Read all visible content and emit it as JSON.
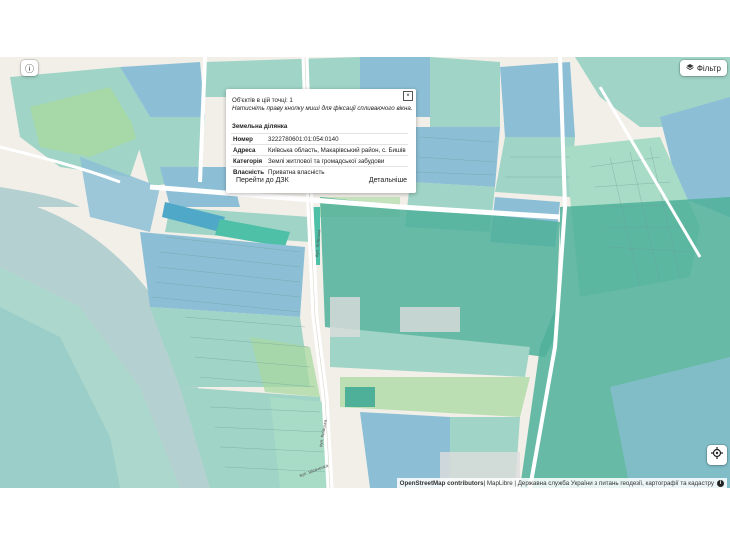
{
  "controls": {
    "info_icon": "ⓘ",
    "filter_label": "Фільтр",
    "locate_icon": "crosshair-icon"
  },
  "popup": {
    "count_text": "Об'єктів в цій точці: 1",
    "hint_text": "Натисніть праву кнопку миші для фіксації спливаючого вікна.",
    "close_label": "×",
    "section_title": "Земельна ділянка",
    "rows": [
      {
        "key": "Номер",
        "value": "3222780601:01:054:0140"
      },
      {
        "key": "Адреса",
        "value": "Київська область, Макарівський район, с. Бишів"
      },
      {
        "key": "Категорія",
        "value": "Землі житлової та громадської забудови"
      },
      {
        "key": "Власність",
        "value": "Приватна власність"
      }
    ],
    "link_dzk": "Перейти до ДЗК",
    "link_more": "Детальніше"
  },
  "attribution": {
    "osm": "OpenStreetMap contributors",
    "rest": " | MapLibre | Державна служба України з питань геодезії, картографії та кадастру"
  },
  "road_labels": [
    "вул. Київська",
    "вул. Київська",
    "вул. Шевченка"
  ],
  "colors": {
    "water": "#b5d0d0",
    "parcel_teal": "#9fd4c6",
    "parcel_blue": "#8cbfd6",
    "parcel_dark": "#4fb09a",
    "parcel_green": "#a8d8a0",
    "land": "#f2efe9"
  }
}
